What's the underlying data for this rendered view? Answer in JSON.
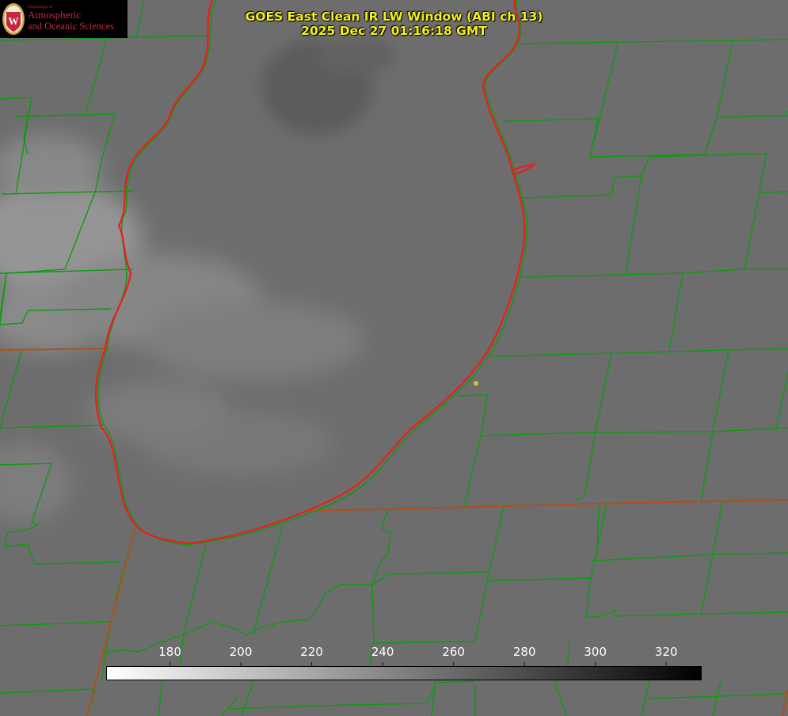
{
  "header": {
    "title_line1": "GOES East Clean IR LW Window (ABI ch 13)",
    "title_line2": "2025 Dec 27 01:16:18 GMT"
  },
  "logo": {
    "dept": "Department of",
    "line1": "Atmospheric",
    "line2": "and Oceanic Sciences",
    "seal_letter": "W"
  },
  "colorbar": {
    "ticks": [
      "180",
      "200",
      "220",
      "240",
      "260",
      "280",
      "300",
      "320"
    ],
    "min": 162,
    "max": 330,
    "gradient_from": "#ffffff",
    "gradient_to": "#000000"
  },
  "colors": {
    "county_lines": "#0f9a12",
    "state_lines": "#b0501a",
    "lake_outline": "#ee1c1c",
    "title_text": "#f2ef1a",
    "marker": "#d8c51a"
  }
}
